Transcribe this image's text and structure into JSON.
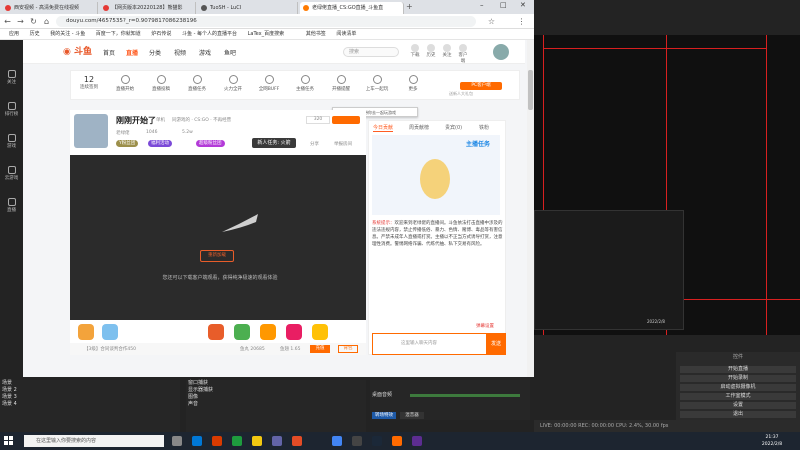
{
  "browser": {
    "tabs": [
      {
        "label": "西安视频 - 高清免费在线视频"
      },
      {
        "label": "【网页版本20220128】熊猫影"
      },
      {
        "label": "TuoSH - LuCI"
      },
      {
        "label": "老绿佬直播_CS:GO直播_斗鱼直"
      }
    ],
    "url": "douyu.com/4657535?_r=0.9079817086238196",
    "bookmarks": [
      "应用",
      "历史",
      "我的关注 - 斗鱼",
      "百度一下，你就知道",
      "炉石传说",
      "斗鱼 - 每个人的直播平台",
      "LaTex_百度搜索",
      "其他书签",
      "阅读清单"
    ]
  },
  "douyu": {
    "leftbar": [
      "关注",
      "排行榜",
      "游戏",
      "云游戏",
      "直播"
    ],
    "nav": [
      "首页",
      "直播",
      "分类",
      "视频",
      "游戏",
      "鱼吧"
    ],
    "search_placeholder": "搜索",
    "header_icons": [
      "下载",
      "历史",
      "关注",
      "客户端"
    ],
    "tools": [
      {
        "value": "12",
        "label": "连续签到"
      },
      {
        "label": "直播开始"
      },
      {
        "label": "直播投稿"
      },
      {
        "label": "直播任务"
      },
      {
        "label": "火力全开"
      },
      {
        "label": "全网BUFF"
      },
      {
        "label": "主播任务"
      },
      {
        "label": "开播提醒"
      },
      {
        "label": "上车一起玩"
      },
      {
        "label": "更多"
      }
    ],
    "pc_client": "PC客户端",
    "pc_sub": "送新人大礼包",
    "tooltip": "开始上车功能，带你去一起玩游戏",
    "room_title": "刚刚开始了",
    "room_meta": [
      "单机",
      "同游戏的 · CS:GO · 不再经营",
      "老绿佬",
      "1046",
      "5.2w"
    ],
    "follow_count": "320",
    "badges": [
      "Y粉丝团",
      "福利活动",
      "超级粉丝团"
    ],
    "new_task": "新人任务: 火箭",
    "share": "分享",
    "report": "举报房间",
    "video_loading": "重新加载",
    "video_tip": "您还可以下载客户端观看，获得纯净极速的观看体验",
    "bottom_left": "【3级】合同谈判合作450",
    "bottom_right": [
      "鱼丸 20685",
      "鱼翅 1.65"
    ],
    "bottom_btns": [
      "充值",
      "背包"
    ],
    "chat_tabs": [
      "今日贡献",
      "周贡献榜",
      "贵宾(0)",
      "铁粉"
    ],
    "chat_promo": "主播任务",
    "system_notice_label": "系统提示：",
    "system_notice": "欢迎来到老绿佬的直播间。斗鱼依法打击直播中涉及的违法违规内容，禁止传播低俗、暴力、色情、赌博、毒品等有害信息。严禁未成年人直播或打赏。主播以不正当方式诱导打赏，注意理性消费。警惕网络诈骗、代练代抽、私下交易有风险。",
    "chat_input_placeholder": "这里输入聊天内容",
    "send": "发送",
    "chat_report": "弹幕设置"
  },
  "obs": {
    "scenes": [
      "场景",
      "场景 2",
      "场景 3",
      "场景 4"
    ],
    "sources": [
      "窗口捕获",
      "显示器捕获",
      "图像",
      "声音"
    ],
    "mixer": [
      "桌面音频",
      "麦克风/Aux"
    ],
    "mixer_btns": [
      "转场特效",
      "混音器"
    ],
    "controls": [
      "控件",
      "开始直播",
      "开始录制",
      "启动虚拟摄像机",
      "工作室模式",
      "设置",
      "退出"
    ],
    "status": "LIVE: 00:00:00   REC: 00:00:00   CPU: 2.4%, 30.00 fps",
    "mini_time": "2022/2/8"
  },
  "taskbar": {
    "search": "在这里输入你要搜索的内容",
    "time": "21:37",
    "date": "2022/2/8"
  }
}
